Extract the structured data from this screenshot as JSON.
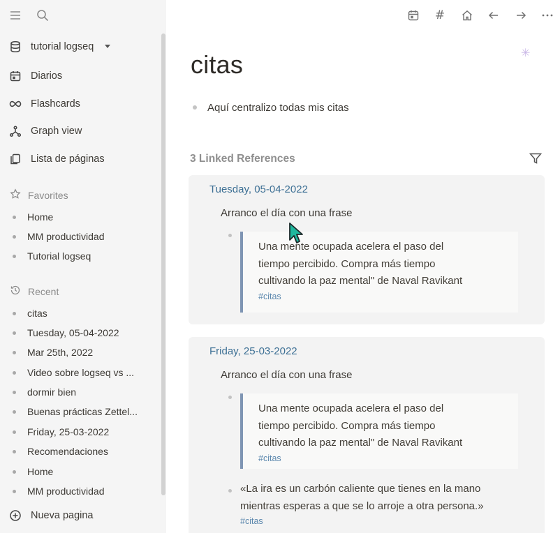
{
  "sidebar": {
    "graph_name": "tutorial logseq",
    "nav": [
      {
        "label": "Diarios",
        "icon": "calendar-icon"
      },
      {
        "label": "Flashcards",
        "icon": "infinity-icon"
      },
      {
        "label": "Graph view",
        "icon": "graph-icon"
      },
      {
        "label": "Lista de páginas",
        "icon": "pages-icon"
      }
    ],
    "favorites_label": "Favorites",
    "favorites": [
      "Home",
      "MM productividad",
      "Tutorial logseq"
    ],
    "recent_label": "Recent",
    "recent": [
      "citas",
      "Tuesday, 05-04-2022",
      "Mar 25th, 2022",
      "Video sobre logseq vs ...",
      "dormir bien",
      "Buenas prácticas Zettel...",
      "Friday, 25-03-2022",
      "Recomendaciones",
      "Home",
      "MM productividad"
    ],
    "new_page_label": "Nueva pagina"
  },
  "header": {
    "hash_glyph": "#",
    "icons": [
      "calendar-icon",
      "hash-icon",
      "home-icon",
      "arrow-left-icon",
      "arrow-right-icon",
      "more-icon"
    ]
  },
  "page": {
    "title": "citas",
    "block": "Aquí centralizo todas mis citas"
  },
  "linked": {
    "title": "3 Linked References",
    "refs": [
      {
        "date": "Tuesday, 05-04-2022",
        "block": "Arranco el día con una frase",
        "quote_lines": [
          "Una mente ocupada acelera el paso del",
          "tiempo percibido. Compra más tiempo",
          "cultivando la paz mental\" de Naval Ravikant"
        ],
        "tag": "#citas"
      },
      {
        "date": "Friday, 25-03-2022",
        "block": "Arranco el día con una frase",
        "quote_lines": [
          "Una mente ocupada acelera el paso del",
          "tiempo percibido. Compra más tiempo",
          "cultivando la paz mental\" de Naval Ravikant"
        ],
        "tag": "#citas",
        "extra_lines": [
          "«La ira es un carbón caliente que tienes en la mano",
          "mientras esperas a que se lo arroje a otra persona.»"
        ],
        "extra_tag": "#citas"
      }
    ]
  },
  "colors": {
    "sidebar_bg": "#f5f5f5",
    "link_date": "#3c6f94",
    "tag": "#5b87ad",
    "quote_border": "#7f95b3",
    "card_bg": "#f3f3f3",
    "cursor": "#1fb89e"
  }
}
